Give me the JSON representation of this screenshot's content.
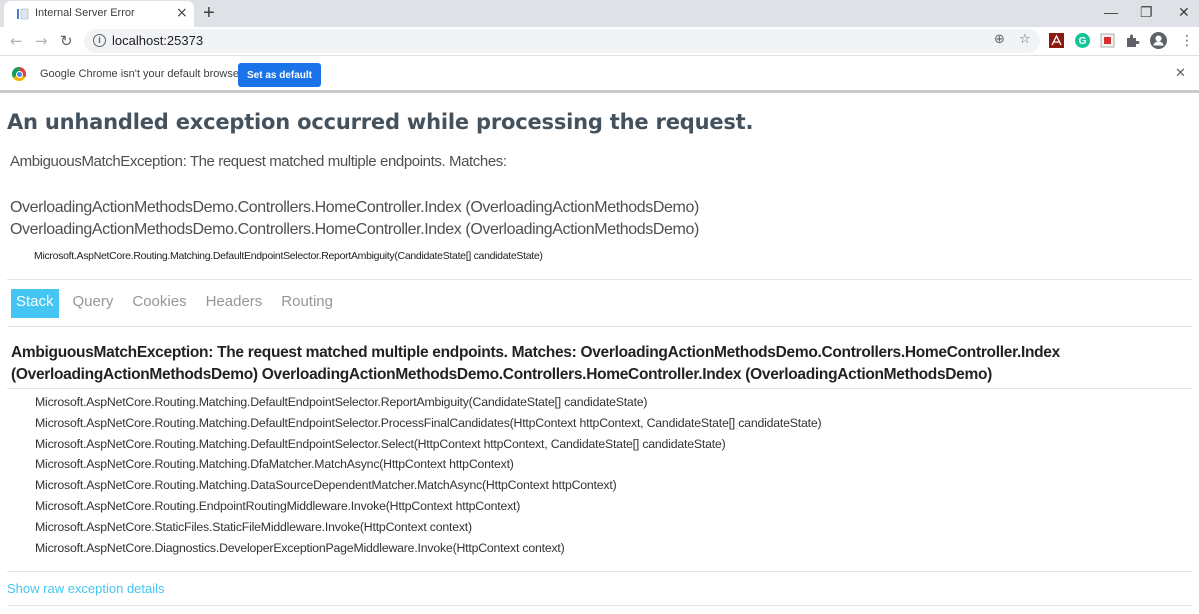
{
  "browser": {
    "tab_title": "Internal Server Error",
    "tab_close_glyph": "×",
    "new_tab_glyph": "+",
    "window_controls": {
      "minimize": "—",
      "restore": "❐",
      "close": "✕"
    },
    "nav": {
      "back": "←",
      "forward": "→",
      "reload": "↻"
    },
    "url": "localhost:25373",
    "info_glyph": "i",
    "omnibox_icons": {
      "zoom": "⊕",
      "bookmark": "☆"
    },
    "extensions": [
      "acrobat-extension",
      "grammarly-extension",
      "red-extension",
      "extensions-puzzle",
      "profile",
      "menu"
    ],
    "extension_colors": {
      "acrobat": "#8b1a10",
      "grammarly": "#15c39a",
      "accent": "#1a73e8"
    },
    "menu_glyph": "⋮",
    "profile_glyph": "●",
    "puzzle_glyph": "✱"
  },
  "infobar": {
    "message": "Google Chrome isn't your default browser",
    "button_label": "Set as default",
    "close_glyph": "✕"
  },
  "page": {
    "title": "An unhandled exception occurred while processing the request.",
    "summary": "AmbiguousMatchException: The request matched multiple endpoints. Matches:",
    "matches": [
      "OverloadingActionMethodsDemo.Controllers.HomeController.Index (OverloadingActionMethodsDemo)",
      "OverloadingActionMethodsDemo.Controllers.HomeController.Index (OverloadingActionMethodsDemo)"
    ],
    "location": "Microsoft.AspNetCore.Routing.Matching.DefaultEndpointSelector.ReportAmbiguity(CandidateState[] candidateState)",
    "tabs": [
      {
        "label": "Stack",
        "active": true
      },
      {
        "label": "Query",
        "active": false
      },
      {
        "label": "Cookies",
        "active": false
      },
      {
        "label": "Headers",
        "active": false
      },
      {
        "label": "Routing",
        "active": false
      }
    ],
    "stack_title": "AmbiguousMatchException: The request matched multiple endpoints. Matches: OverloadingActionMethodsDemo.Controllers.HomeController.Index (OverloadingActionMethodsDemo) OverloadingActionMethodsDemo.Controllers.HomeController.Index (OverloadingActionMethodsDemo)",
    "frames": [
      "Microsoft.AspNetCore.Routing.Matching.DefaultEndpointSelector.ReportAmbiguity(CandidateState[] candidateState)",
      "Microsoft.AspNetCore.Routing.Matching.DefaultEndpointSelector.ProcessFinalCandidates(HttpContext httpContext, CandidateState[] candidateState)",
      "Microsoft.AspNetCore.Routing.Matching.DefaultEndpointSelector.Select(HttpContext httpContext, CandidateState[] candidateState)",
      "Microsoft.AspNetCore.Routing.Matching.DfaMatcher.MatchAsync(HttpContext httpContext)",
      "Microsoft.AspNetCore.Routing.Matching.DataSourceDependentMatcher.MatchAsync(HttpContext httpContext)",
      "Microsoft.AspNetCore.Routing.EndpointRoutingMiddleware.Invoke(HttpContext httpContext)",
      "Microsoft.AspNetCore.StaticFiles.StaticFileMiddleware.Invoke(HttpContext context)",
      "Microsoft.AspNetCore.Diagnostics.DeveloperExceptionPageMiddleware.Invoke(HttpContext context)"
    ],
    "raw_link": "Show raw exception details",
    "colors": {
      "title": "#44525e",
      "accent": "#44c5f2"
    }
  }
}
